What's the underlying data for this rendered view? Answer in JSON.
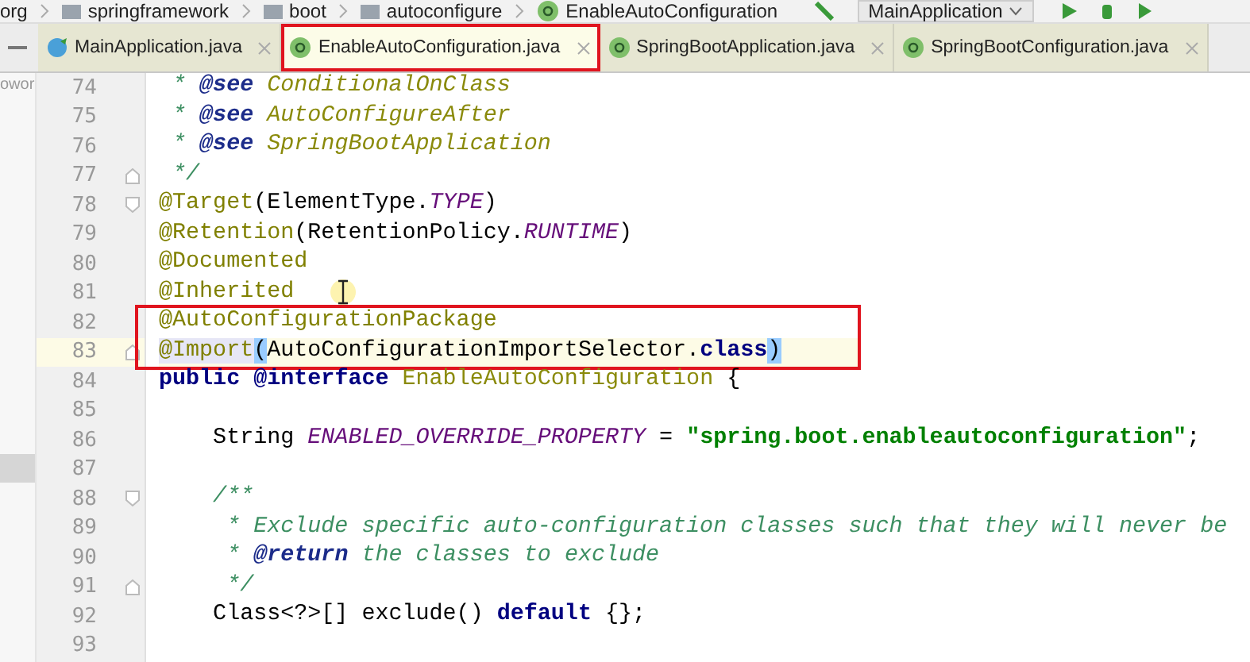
{
  "breadcrumb": [
    "org",
    "springframework",
    "boot",
    "autoconfigure",
    "EnableAutoConfiguration"
  ],
  "run_config": {
    "label": "MainApplication"
  },
  "side_panel": {
    "text": "owor"
  },
  "tabs": [
    {
      "label": "MainApplication.java",
      "kind": "class",
      "selected": false,
      "outlined": false
    },
    {
      "label": "EnableAutoConfiguration.java",
      "kind": "annotation",
      "selected": true,
      "outlined": true
    },
    {
      "label": "SpringBootApplication.java",
      "kind": "annotation",
      "selected": false,
      "outlined": false
    },
    {
      "label": "SpringBootConfiguration.java",
      "kind": "annotation",
      "selected": false,
      "outlined": false
    }
  ],
  "blocks": [
    {
      "outlined": false,
      "lines": [
        {
          "number": "74",
          "kind": "plain",
          "current": false,
          "tokens": [
            {
              "kind": "doc",
              "text": " * "
            },
            {
              "kind": "doc-tag",
              "text": "@see"
            },
            {
              "kind": "doc-ref",
              "text": " ConditionalOnClass"
            }
          ]
        },
        {
          "number": "75",
          "kind": "plain",
          "current": false,
          "tokens": [
            {
              "kind": "doc",
              "text": " * "
            },
            {
              "kind": "doc-tag",
              "text": "@see"
            },
            {
              "kind": "doc-ref",
              "text": " AutoConfigureAfter"
            }
          ]
        },
        {
          "number": "76",
          "kind": "plain",
          "current": false,
          "tokens": [
            {
              "kind": "doc",
              "text": " * "
            },
            {
              "kind": "doc-tag",
              "text": "@see"
            },
            {
              "kind": "doc-ref",
              "text": " SpringBootApplication"
            }
          ]
        },
        {
          "number": "77",
          "kind": "fold-end",
          "current": false,
          "tokens": [
            {
              "kind": "doc",
              "text": " */"
            }
          ]
        },
        {
          "number": "78",
          "kind": "fold-start",
          "current": false,
          "tokens": [
            {
              "kind": "annotation",
              "text": "@Target"
            },
            {
              "kind": "plain",
              "text": "(ElementType."
            },
            {
              "kind": "constant",
              "text": "TYPE"
            },
            {
              "kind": "plain",
              "text": ")"
            }
          ]
        },
        {
          "number": "79",
          "kind": "plain",
          "current": false,
          "tokens": [
            {
              "kind": "annotation",
              "text": "@Retention"
            },
            {
              "kind": "plain",
              "text": "(RetentionPolicy."
            },
            {
              "kind": "constant",
              "text": "RUNTIME"
            },
            {
              "kind": "plain",
              "text": ")"
            }
          ]
        },
        {
          "number": "80",
          "kind": "plain",
          "current": false,
          "tokens": [
            {
              "kind": "annotation",
              "text": "@Documented"
            }
          ]
        },
        {
          "number": "81",
          "kind": "plain",
          "current": false,
          "tokens": [
            {
              "kind": "annotation",
              "text": "@Inherited"
            }
          ]
        }
      ]
    },
    {
      "outlined": true,
      "lines": [
        {
          "number": "82",
          "kind": "plain",
          "current": false,
          "tokens": [
            {
              "kind": "annotation",
              "text": "@AutoConfigurationPackage"
            }
          ]
        },
        {
          "number": "83",
          "kind": "fold-end",
          "current": true,
          "tokens": [
            {
              "kind": "annotation-match",
              "text": "@Import"
            },
            {
              "kind": "brace-match",
              "text": "("
            },
            {
              "kind": "plain",
              "text": "AutoConfigurationImportSelector."
            },
            {
              "kind": "keyword",
              "text": "class"
            },
            {
              "kind": "brace-match",
              "text": ")"
            }
          ]
        }
      ]
    },
    {
      "outlined": false,
      "lines": [
        {
          "number": "84",
          "kind": "plain",
          "current": false,
          "tokens": [
            {
              "kind": "keyword",
              "text": "public"
            },
            {
              "kind": "keyword",
              "text": " @interface"
            },
            {
              "kind": "declaration",
              "text": " EnableAutoConfiguration"
            },
            {
              "kind": "plain",
              "text": " {"
            }
          ]
        },
        {
          "number": "85",
          "kind": "plain",
          "current": false
        },
        {
          "number": "86",
          "kind": "plain",
          "current": false,
          "tokens": [
            {
              "kind": "plain",
              "text": "    String "
            },
            {
              "kind": "constant",
              "text": "ENABLED_OVERRIDE_PROPERTY"
            },
            {
              "kind": "plain",
              "text": " = "
            },
            {
              "kind": "string",
              "text": "\"spring.boot.enableautoconfiguration\""
            },
            {
              "kind": "plain",
              "text": ";"
            }
          ]
        },
        {
          "number": "87",
          "kind": "plain",
          "current": false
        },
        {
          "number": "88",
          "kind": "fold-start",
          "current": false,
          "tokens": [
            {
              "kind": "doc",
              "text": "    /**"
            }
          ]
        },
        {
          "number": "89",
          "kind": "plain",
          "current": false,
          "tokens": [
            {
              "kind": "doc",
              "text": "     * Exclude specific auto-configuration classes such that they will never be"
            }
          ]
        },
        {
          "number": "90",
          "kind": "plain",
          "current": false,
          "tokens": [
            {
              "kind": "doc",
              "text": "     * "
            },
            {
              "kind": "doc-tag",
              "text": "@return"
            },
            {
              "kind": "doc",
              "text": " the classes to exclude"
            }
          ]
        },
        {
          "number": "91",
          "kind": "fold-end",
          "current": false,
          "tokens": [
            {
              "kind": "doc",
              "text": "     */"
            }
          ]
        },
        {
          "number": "92",
          "kind": "plain",
          "current": false,
          "tokens": [
            {
              "kind": "plain",
              "text": "    Class<?>[] exclude() "
            },
            {
              "kind": "keyword",
              "text": "default"
            },
            {
              "kind": "plain",
              "text": " {};"
            }
          ]
        },
        {
          "number": "93",
          "kind": "plain",
          "current": false
        }
      ]
    }
  ]
}
